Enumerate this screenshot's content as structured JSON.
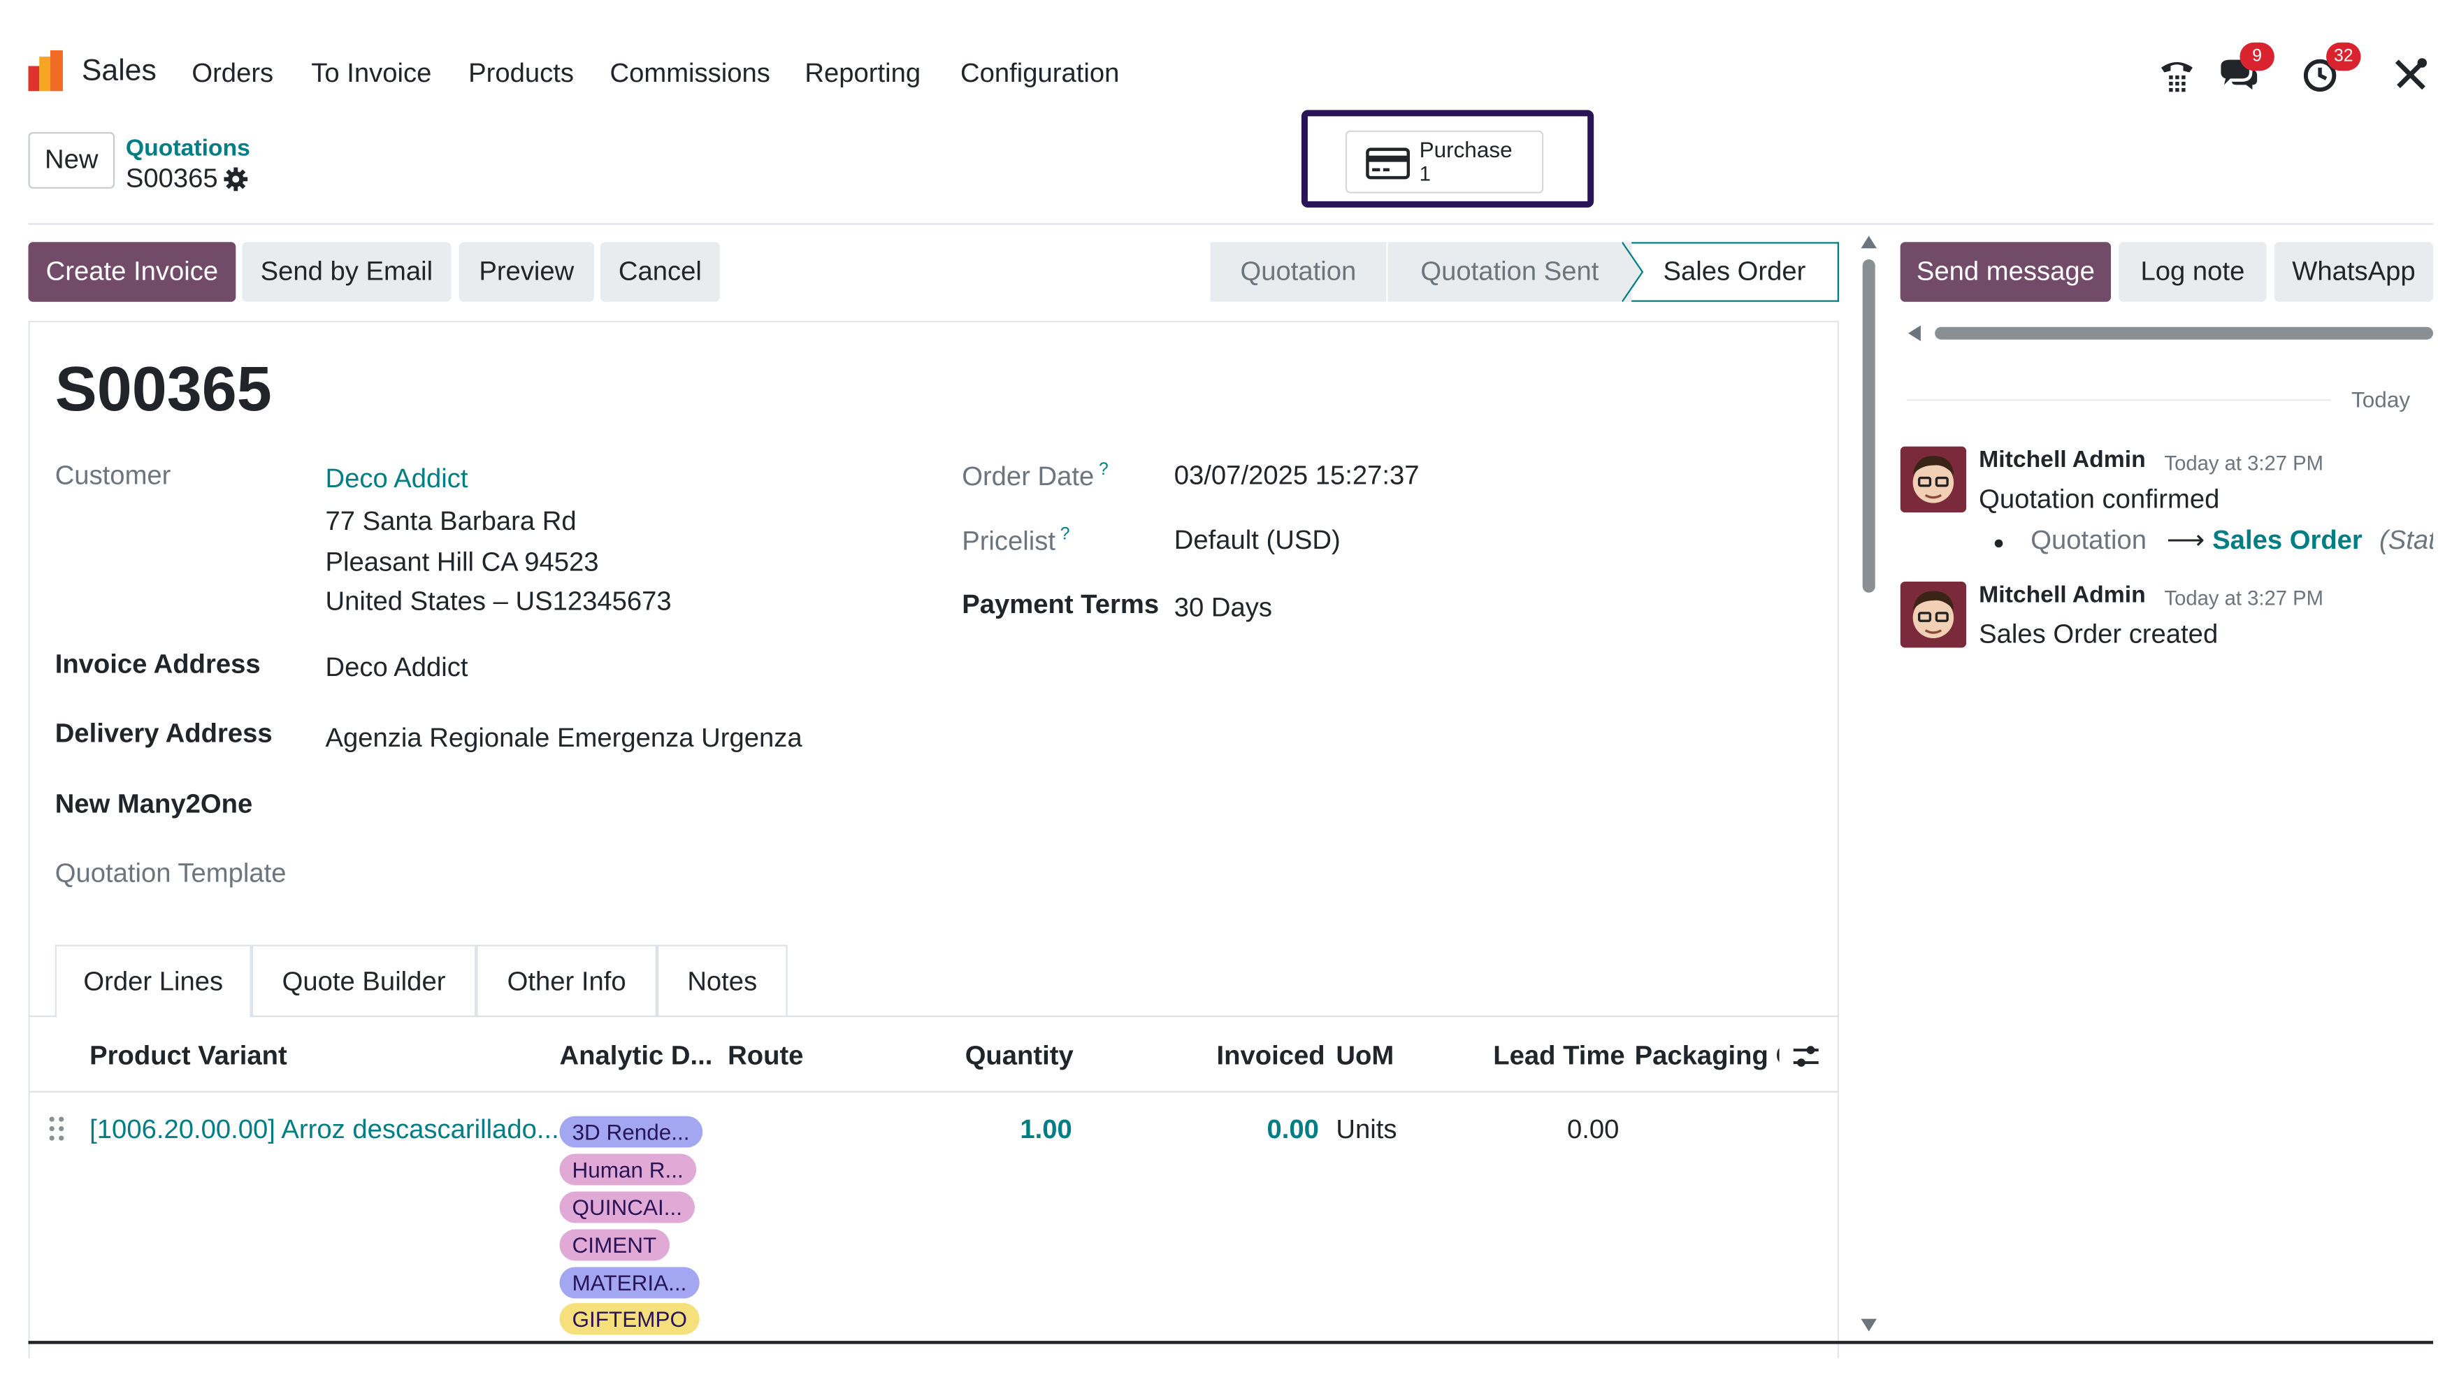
{
  "colors": {
    "primary": "#714b67",
    "link": "#017e84",
    "highlight_border": "#2a1458",
    "badge": "#d9232e"
  },
  "nav": {
    "app_name": "Sales",
    "menu": [
      "Orders",
      "To Invoice",
      "Products",
      "Commissions",
      "Reporting",
      "Configuration"
    ],
    "icons": [
      "phone-icon",
      "chat-icon",
      "activity-clock-icon",
      "tools-icon"
    ],
    "messages_badge": "9",
    "activities_badge": "32"
  },
  "control": {
    "new_label": "New",
    "breadcrumb_parent": "Quotations",
    "breadcrumb_current": "S00365",
    "smart_button": {
      "label": "Purchase",
      "count": "1",
      "icon": "credit-card-icon"
    }
  },
  "actions": {
    "create_invoice": "Create Invoice",
    "send_email": "Send by Email",
    "preview": "Preview",
    "cancel": "Cancel"
  },
  "stages": [
    "Quotation",
    "Quotation Sent",
    "Sales Order"
  ],
  "active_stage": "Sales Order",
  "record": {
    "name": "S00365",
    "customer_label": "Customer",
    "customer_name": "Deco Addict",
    "customer_address": [
      "77 Santa Barbara Rd",
      "Pleasant Hill CA 94523",
      "United States – US12345673"
    ],
    "invoice_address_label": "Invoice Address",
    "invoice_address": "Deco Addict",
    "delivery_address_label": "Delivery Address",
    "delivery_address": "Agenzia Regionale Emergenza Urgenza",
    "many2one_label": "New Many2One",
    "template_label": "Quotation Template",
    "order_date_label": "Order Date",
    "order_date": "03/07/2025 15:27:37",
    "pricelist_label": "Pricelist",
    "pricelist": "Default (USD)",
    "payment_terms_label": "Payment Terms",
    "payment_terms": "30 Days"
  },
  "tabs": [
    "Order Lines",
    "Quote Builder",
    "Other Info",
    "Notes"
  ],
  "table": {
    "headers": {
      "product": "Product Variant",
      "analytic": "Analytic D...",
      "route": "Route",
      "quantity": "Quantity",
      "invoiced": "Invoiced",
      "uom": "UoM",
      "lead_time": "Lead Time",
      "packaging": "Packaging C"
    },
    "row": {
      "product": "[1006.20.00.00] Arroz descascarillado...",
      "tags": [
        {
          "label": "3D Rende...",
          "color": "#a3a7f2"
        },
        {
          "label": "Human R...",
          "color": "#e0a9d6"
        },
        {
          "label": "QUINCAI...",
          "color": "#e0a9d6"
        },
        {
          "label": "CIMENT",
          "color": "#e0a9d6"
        },
        {
          "label": "MATERIA...",
          "color": "#a3a7f2"
        },
        {
          "label": "GIFTEMPO",
          "color": "#f6e07b"
        }
      ],
      "quantity": "1.00",
      "invoiced": "0.00",
      "uom": "Units",
      "lead_time": "0.00"
    }
  },
  "chatter": {
    "send_message": "Send message",
    "log_note": "Log note",
    "whatsapp": "WhatsApp",
    "today": "Today",
    "messages": [
      {
        "author": "Mitchell Admin",
        "time": "Today at 3:27 PM",
        "body": "Quotation confirmed",
        "tracking_from": "Quotation",
        "tracking_to": "Sales Order",
        "tracking_field": "(Status)"
      },
      {
        "author": "Mitchell Admin",
        "time": "Today at 3:27 PM",
        "body": "Sales Order created"
      }
    ]
  }
}
